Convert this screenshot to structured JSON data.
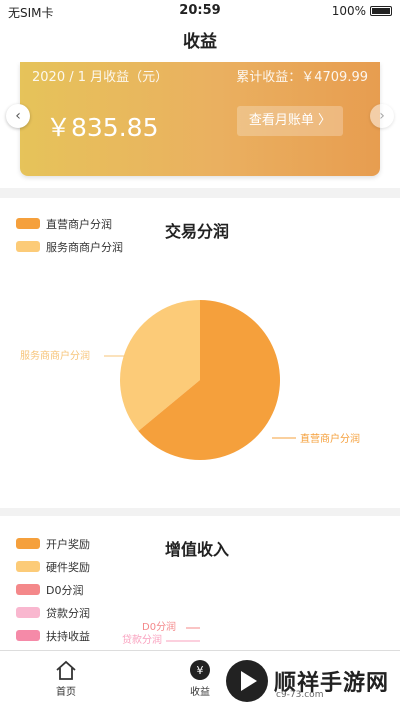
{
  "status": {
    "carrier": "无SIM卡",
    "time": "20:59",
    "battery": "100%"
  },
  "nav": {
    "title": "收益"
  },
  "earnings": {
    "month_label": "2020 / 1 月收益（元）",
    "total_label": "累计收益：￥4709.99",
    "amount": "￥835.85",
    "bill_button": "查看月账单 〉",
    "prev": "‹",
    "next": "›"
  },
  "trade": {
    "title": "交易分润",
    "legend": [
      {
        "label": "直营商户分润",
        "color": "#f5a03c"
      },
      {
        "label": "服务商商户分润",
        "color": "#fccb78"
      }
    ],
    "slice_labels": {
      "direct": "直营商户分润",
      "service": "服务商商户分润"
    }
  },
  "value_added": {
    "title": "增值收入",
    "legend": [
      {
        "label": "开户奖励",
        "color": "#f5a03c"
      },
      {
        "label": "硬件奖励",
        "color": "#fccb78"
      },
      {
        "label": "D0分润",
        "color": "#f4888a"
      },
      {
        "label": "贷款分润",
        "color": "#f9b7cf"
      },
      {
        "label": "扶持收益",
        "color": "#f58aa8"
      }
    ],
    "slice_labels": {
      "d0": "D0分润",
      "loan": "贷款分润",
      "support": "扶持收益"
    }
  },
  "chart_data": {
    "type": "pie",
    "title": "交易分润",
    "categories": [
      "直营商户分润",
      "服务商商户分润"
    ],
    "values": [
      64,
      36
    ],
    "colors": [
      "#f5a03c",
      "#fccb78"
    ]
  },
  "tabs": [
    {
      "label": "首页",
      "icon": "home-icon"
    },
    {
      "label": "收益",
      "icon": "yuan-icon"
    }
  ],
  "watermark": {
    "text": "顺祥手游网",
    "sub": "c9-73.com"
  }
}
